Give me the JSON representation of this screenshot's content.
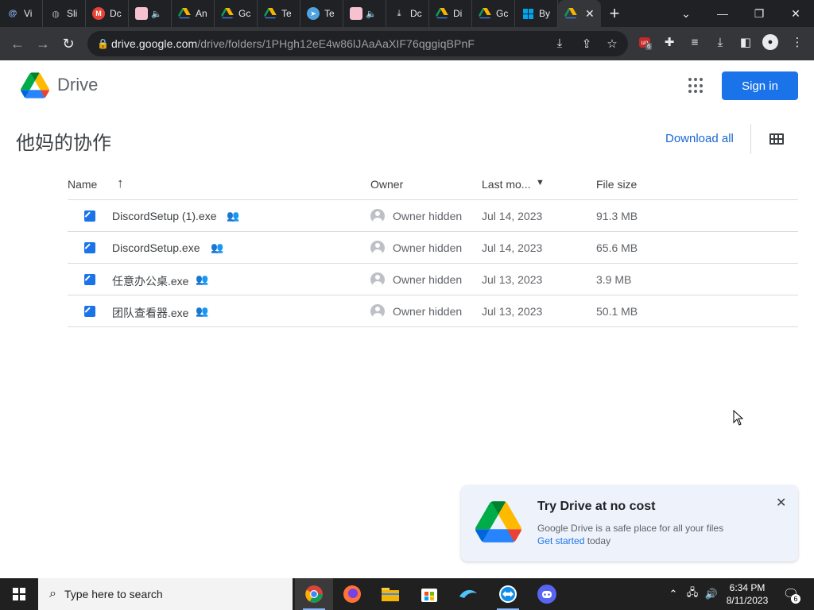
{
  "browser": {
    "tabs": [
      {
        "label": "Vi",
        "icon": "at-sign-icon",
        "color": "#8ab4f8"
      },
      {
        "label": "Sli",
        "icon": "globe-icon",
        "color": "#9aa0a6"
      },
      {
        "label": "Dc",
        "icon": "mail-icon",
        "color": "#ea4335"
      },
      {
        "label": "",
        "icon": "anime-avatar-icon",
        "color": "#f28b82"
      },
      {
        "label": "An",
        "icon": "drive-icon",
        "color": "#34a853"
      },
      {
        "label": "Gc",
        "icon": "drive-icon",
        "color": "#34a853"
      },
      {
        "label": "Te",
        "icon": "drive-icon",
        "color": "#34a853"
      },
      {
        "label": "Te",
        "icon": "telegram-icon",
        "color": "#4fa3e0"
      },
      {
        "label": "",
        "icon": "anime-avatar-icon",
        "color": "#f28b82"
      },
      {
        "label": "Dc",
        "icon": "download-icon",
        "color": "#e8eaed"
      },
      {
        "label": "Di",
        "icon": "drive-icon",
        "color": "#34a853"
      },
      {
        "label": "Gc",
        "icon": "drive-icon",
        "color": "#34a853"
      },
      {
        "label": "By",
        "icon": "windows-icon",
        "color": "#00a4ef"
      }
    ],
    "url_host": "drive.google.com",
    "url_path": "/drive/folders/1PHgh12eE4w86lJAaAaXIF76qggiqBPnF",
    "extension_badge": "6"
  },
  "drive": {
    "brand": "Drive",
    "sign_in": "Sign in",
    "folder_name": "他妈的协作",
    "download_all": "Download all",
    "columns": {
      "name": "Name",
      "owner": "Owner",
      "modified": "Last mo...",
      "size": "File size"
    },
    "files": [
      {
        "name": "DiscordSetup (1).exe",
        "owner": "Owner hidden",
        "modified": "Jul 14, 2023",
        "size": "91.3 MB"
      },
      {
        "name": "DiscordSetup.exe",
        "owner": "Owner hidden",
        "modified": "Jul 14, 2023",
        "size": "65.6 MB"
      },
      {
        "name": "任意办公桌.exe",
        "owner": "Owner hidden",
        "modified": "Jul 13, 2023",
        "size": "3.9 MB"
      },
      {
        "name": "团队查看器.exe",
        "owner": "Owner hidden",
        "modified": "Jul 13, 2023",
        "size": "50.1 MB"
      }
    ],
    "promo": {
      "title": "Try Drive at no cost",
      "body": "Google Drive is a safe place for all your files",
      "link": "Get started",
      "after_link": " today"
    }
  },
  "taskbar": {
    "search_placeholder": "Type here to search",
    "time": "6:34 PM",
    "date": "8/11/2023",
    "notification_count": "6"
  }
}
